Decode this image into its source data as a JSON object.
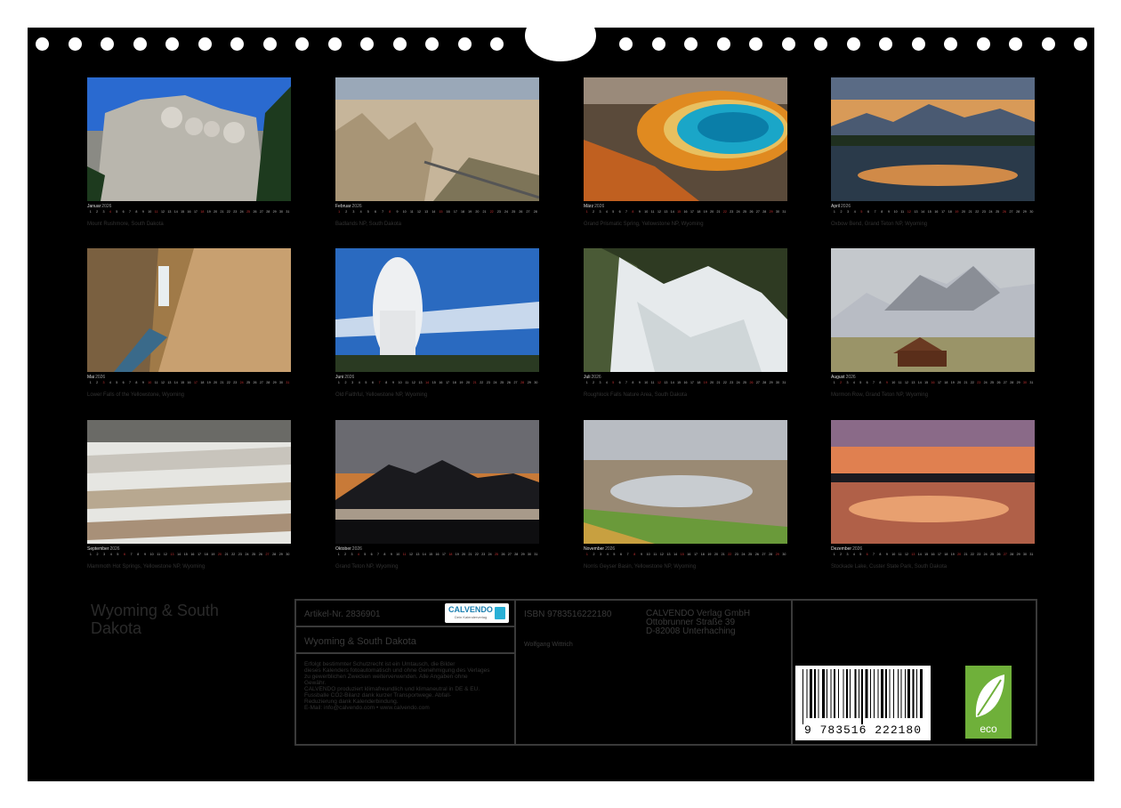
{
  "months": [
    {
      "name": "Januar",
      "year": "2026",
      "caption": "Mount Rushmore, South Dakota",
      "days": 31,
      "sundays": [
        4,
        11,
        18,
        25
      ]
    },
    {
      "name": "Februar",
      "year": "2026",
      "caption": "Badlands NP, South Dakota",
      "days": 28,
      "sundays": [
        1,
        8,
        15,
        22
      ]
    },
    {
      "name": "März",
      "year": "2026",
      "caption": "Grand Prismatic Spring, Yellowstone NP, Wyoming",
      "days": 31,
      "sundays": [
        1,
        8,
        15,
        22,
        29
      ]
    },
    {
      "name": "April",
      "year": "2026",
      "caption": "Oxbow Bend, Grand Teton NP, Wyoming",
      "days": 30,
      "sundays": [
        5,
        12,
        19,
        26
      ]
    },
    {
      "name": "Mai",
      "year": "2026",
      "caption": "Lower Falls of the Yellowstone, Wyoming",
      "days": 31,
      "sundays": [
        3,
        10,
        17,
        24,
        31
      ]
    },
    {
      "name": "Juni",
      "year": "2026",
      "caption": "Old Faithful, Yellowstone NP, Wyoming",
      "days": 30,
      "sundays": [
        7,
        14,
        21,
        28
      ]
    },
    {
      "name": "Juli",
      "year": "2026",
      "caption": "Roughlock Falls Nature Area, South Dakota",
      "days": 31,
      "sundays": [
        5,
        12,
        19,
        26
      ]
    },
    {
      "name": "August",
      "year": "2026",
      "caption": "Mormon Row, Grand Teton NP, Wyoming",
      "days": 31,
      "sundays": [
        2,
        9,
        16,
        23,
        30
      ]
    },
    {
      "name": "September",
      "year": "2026",
      "caption": "Mammoth Hot Springs, Yellowstone NP, Wyoming",
      "days": 30,
      "sundays": [
        6,
        13,
        20,
        27
      ]
    },
    {
      "name": "Oktober",
      "year": "2026",
      "caption": "Grand Teton NP, Wyoming",
      "days": 31,
      "sundays": [
        4,
        11,
        18,
        25
      ]
    },
    {
      "name": "November",
      "year": "2026",
      "caption": "Norris Geyser Basin, Yellowstone NP, Wyoming",
      "days": 30,
      "sundays": [
        1,
        8,
        15,
        22,
        29
      ]
    },
    {
      "name": "Dezember",
      "year": "2026",
      "caption": "Stockade Lake, Custer State Park, South Dakota",
      "days": 31,
      "sundays": [
        6,
        13,
        20,
        27
      ]
    }
  ],
  "calendar_title": "Wyoming & South Dakota",
  "info": {
    "article": "Artikel-Nr. 2836901",
    "logo_text": "CALVENDO",
    "logo_sub": "Dein Kalenderverlag",
    "subtitle": "Wyoming & South Dakota",
    "legal_lines": [
      "Erfolgt bestimmter Schutzrecht ist ein Umtausch, die Bilder",
      "dieses Kalenders fotoautomatisch und ohne Genehmigung des Verlages",
      "zu gewerblichen Zwecken weiterverwenden. Alle Angaben ohne",
      "Gewähr.",
      "CALVENDO produziert klimafreundlich und klimaneutral in DE & EU.",
      "Fussballe CO2-Bilanz dank kurzer Transportwege. Abfall-",
      "Reduzierung dank Kalenderbindung.",
      "E-Mail: info@calvendo.com • www.calvendo.com"
    ],
    "isbn": "ISBN 9783516222180",
    "author": "Wolfgang Wittrich",
    "publisher": [
      "CALVENDO Verlag GmbH",
      "Ottobrunner Straße 39",
      "D-82008 Unterhaching"
    ],
    "barcode_number": "9 783516 222180",
    "eco_label": "eco"
  }
}
